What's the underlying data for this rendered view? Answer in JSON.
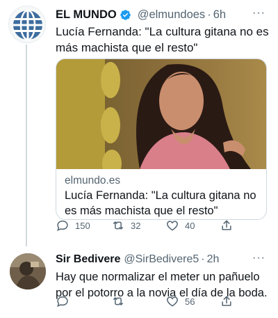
{
  "tweets": [
    {
      "name": "EL MUNDO",
      "handle": "@elmundoes",
      "separator": "·",
      "time": "6h",
      "text": "Lucía Fernanda: \"La cultura gitana no es más machista que el resto\"",
      "verified": true,
      "avatar_icon": "el-mundo-globe-logo",
      "card": {
        "domain": "elmundo.es",
        "title": "Lucía Fernanda: \"La cultura gitana no es más machista que el resto\""
      },
      "actions": {
        "replies": "150",
        "retweets": "32",
        "likes": "40"
      }
    },
    {
      "name": "Sir Bedivere",
      "handle": "@SirBedivere5",
      "separator": "·",
      "time": "2h",
      "text": "Hay que normalizar el meter un pañuelo por el potorro a la novia el día de la boda.",
      "avatar_icon": "user-avatar-photo",
      "actions": {
        "replies": "",
        "retweets": "",
        "likes": "56"
      }
    }
  ],
  "more_label": "···",
  "colors": {
    "verified": "#1d9bf0",
    "secondary_text": "#536471",
    "logo_blue": "#3d6d9e"
  }
}
